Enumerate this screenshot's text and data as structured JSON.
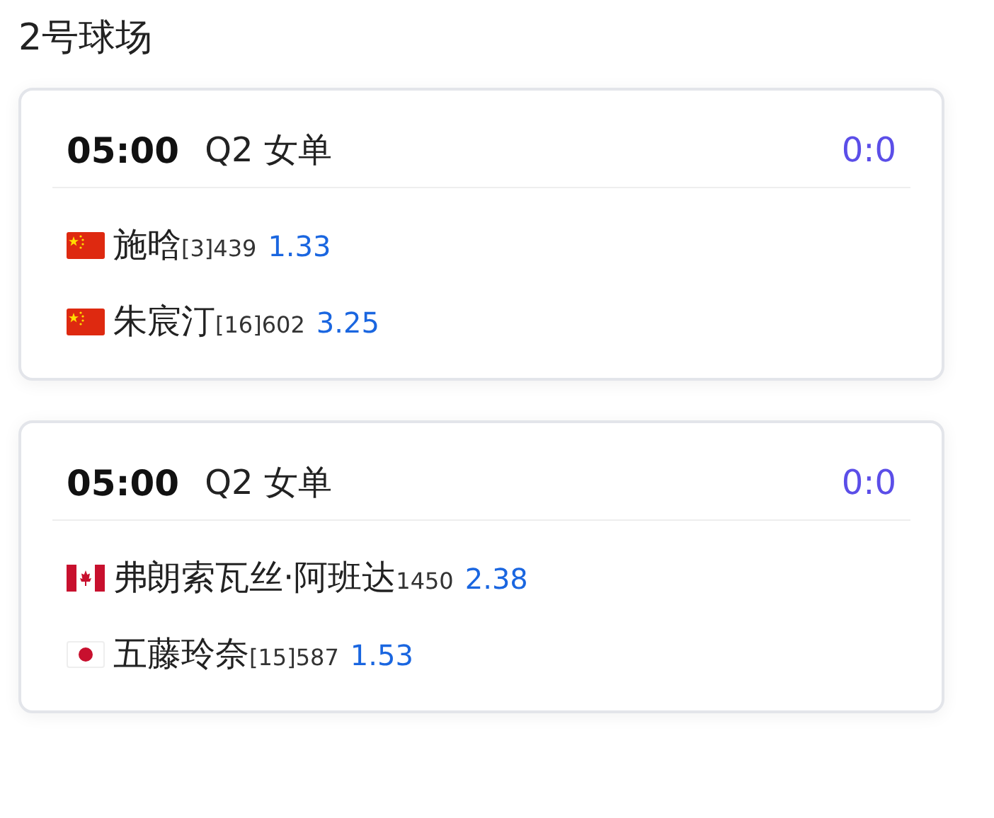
{
  "court": {
    "title": "2号球场"
  },
  "matches": [
    {
      "time": "05:00",
      "round": "Q2 女单",
      "score": "0:0",
      "players": [
        {
          "kind": "cn",
          "name": "施晗",
          "rank": "[3]439",
          "odds": "1.33"
        },
        {
          "kind": "cn",
          "name": "朱宸汀",
          "rank": "[16]602",
          "odds": "3.25"
        }
      ]
    },
    {
      "time": "05:00",
      "round": "Q2 女单",
      "score": "0:0",
      "players": [
        {
          "kind": "ca",
          "name": "弗朗索瓦丝·阿班达",
          "rank": "1450",
          "odds": "2.38"
        },
        {
          "kind": "jp",
          "name": "五藤玲奈",
          "rank": "[15]587",
          "odds": "1.53"
        }
      ]
    }
  ]
}
